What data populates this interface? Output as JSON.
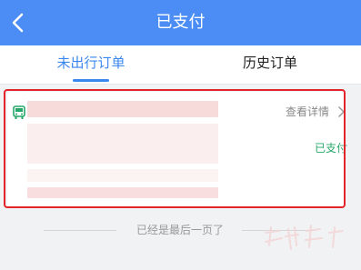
{
  "header": {
    "title": "已支付",
    "back_icon": "back-arrow-icon",
    "background_color": "#4c8df5"
  },
  "tabs": [
    {
      "label": "未出行订单",
      "active": true
    },
    {
      "label": "历史订单",
      "active": false
    }
  ],
  "order": {
    "type_icon": "bus-icon",
    "details_label": "查看详情",
    "status": "已支付",
    "status_color": "#27a86a",
    "highlight_color": "#e3242b"
  },
  "footer": {
    "end_text": "已经是最后一页了"
  }
}
